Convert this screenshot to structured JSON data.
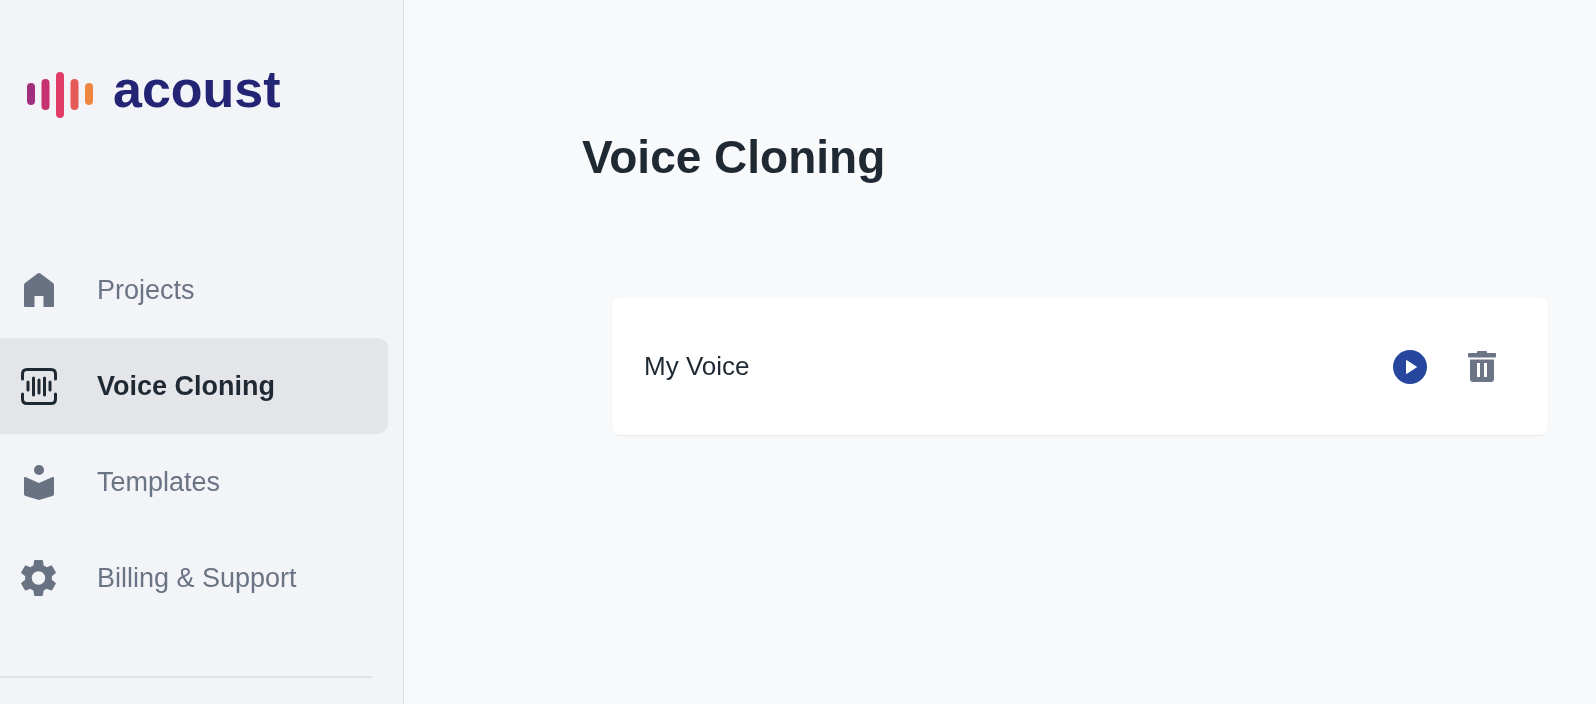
{
  "logo": {
    "text": "acoust"
  },
  "sidebar": {
    "items": [
      {
        "label": "Projects",
        "selected": false
      },
      {
        "label": "Voice Cloning",
        "selected": true
      },
      {
        "label": "Templates",
        "selected": false
      },
      {
        "label": "Billing & Support",
        "selected": false
      }
    ]
  },
  "page": {
    "title": "Voice Cloning"
  },
  "voices": [
    {
      "name": "My Voice"
    }
  ]
}
